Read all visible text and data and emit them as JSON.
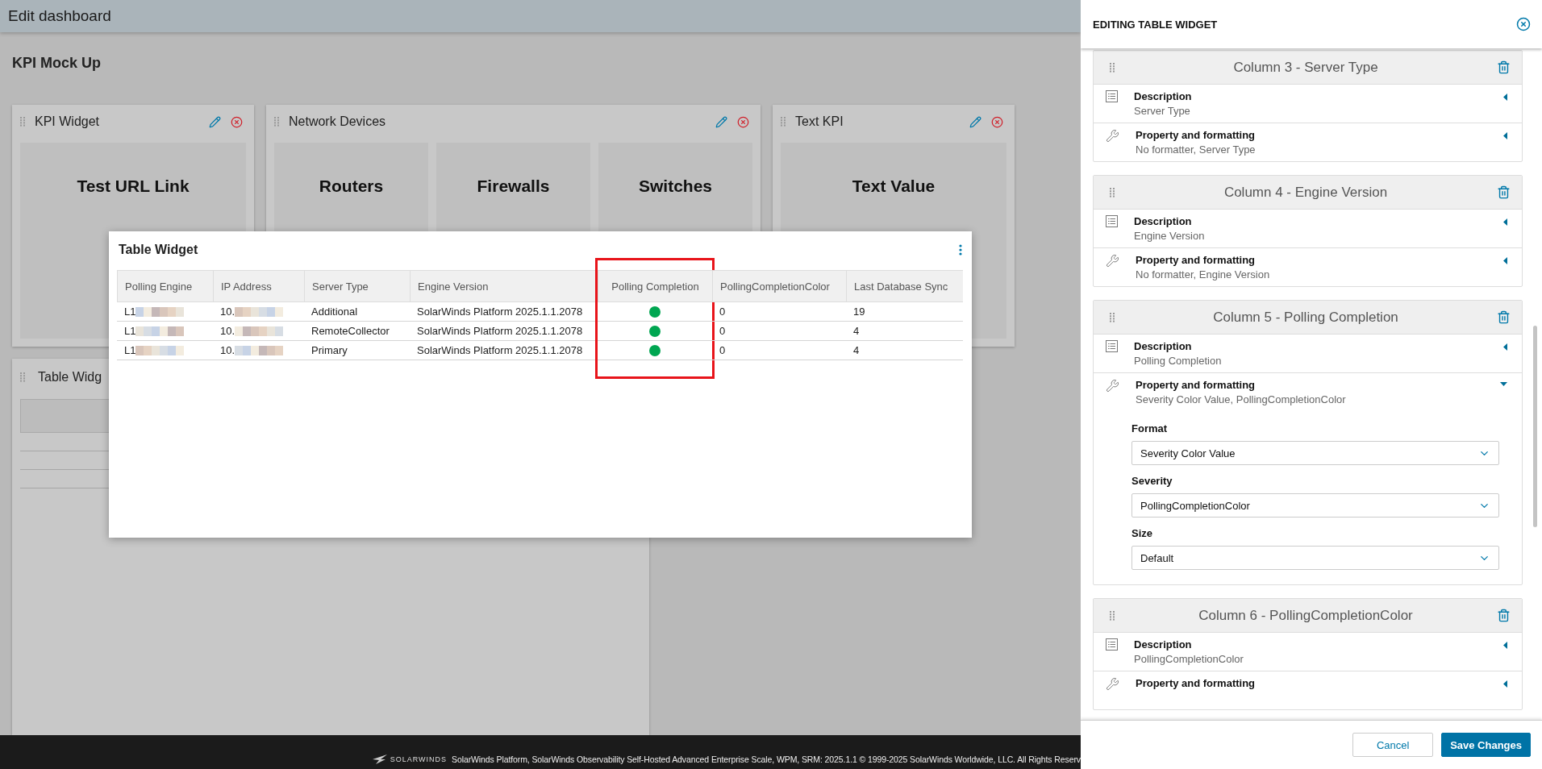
{
  "header": {
    "title": "Edit dashboard"
  },
  "dashboard": {
    "title": "KPI Mock Up",
    "widgets": [
      {
        "title": "KPI Widget",
        "tiles": [
          {
            "label": "Test URL Link"
          }
        ]
      },
      {
        "title": "Network Devices",
        "tiles": [
          {
            "label": "Routers"
          },
          {
            "label": "Firewalls"
          },
          {
            "label": "Switches"
          }
        ]
      },
      {
        "title": "Text KPI",
        "tiles": [
          {
            "label": "Text Value"
          }
        ]
      }
    ],
    "table_widget": {
      "title": "Table Widg"
    }
  },
  "preview": {
    "title": "Table Widget",
    "columns": [
      {
        "label": "Polling Engine",
        "highlighted": false
      },
      {
        "label": "IP Address",
        "highlighted": false
      },
      {
        "label": "Server Type",
        "highlighted": false
      },
      {
        "label": "Engine Version",
        "highlighted": false
      },
      {
        "label": "Polling Completion",
        "highlighted": true
      },
      {
        "label": "PollingCompletionColor",
        "highlighted": false
      },
      {
        "label": "Last Database Sync",
        "highlighted": false
      }
    ],
    "rows": [
      {
        "cells": [
          {
            "kind": "redacted",
            "text": "L1"
          },
          {
            "kind": "redacted",
            "text": "10."
          },
          {
            "kind": "text",
            "text": "Additional"
          },
          {
            "kind": "text",
            "text": "SolarWinds Platform 2025.1.1.2078"
          },
          {
            "kind": "dot",
            "color": "#00a651"
          },
          {
            "kind": "text",
            "text": "0"
          },
          {
            "kind": "text",
            "text": "19"
          }
        ]
      },
      {
        "cells": [
          {
            "kind": "redacted",
            "text": "L1"
          },
          {
            "kind": "redacted",
            "text": "10."
          },
          {
            "kind": "text",
            "text": "RemoteCollector"
          },
          {
            "kind": "text",
            "text": "SolarWinds Platform 2025.1.1.2078"
          },
          {
            "kind": "dot",
            "color": "#00a651"
          },
          {
            "kind": "text",
            "text": "0"
          },
          {
            "kind": "text",
            "text": "4"
          }
        ]
      },
      {
        "cells": [
          {
            "kind": "redacted",
            "text": "L1"
          },
          {
            "kind": "redacted",
            "text": "10."
          },
          {
            "kind": "text",
            "text": "Primary"
          },
          {
            "kind": "text",
            "text": "SolarWinds Platform 2025.1.1.2078"
          },
          {
            "kind": "dot",
            "color": "#00a651"
          },
          {
            "kind": "text",
            "text": "0"
          },
          {
            "kind": "text",
            "text": "4"
          }
        ]
      }
    ]
  },
  "footer": {
    "brand": "SOLARWINDS",
    "text": "SolarWinds Platform, SolarWinds Observability Self-Hosted Advanced Enterprise Scale, WPM, SRM: 2025.1.1 © 1999-2025 SolarWinds Worldwide, LLC. All Rights Reserv"
  },
  "panel": {
    "title": "EDITING TABLE WIDGET",
    "columns": [
      {
        "title": "Column 3 - Server Type",
        "rows": [
          {
            "kind": "description",
            "label": "Description",
            "value": "Server Type",
            "expanded": false
          },
          {
            "kind": "property",
            "label": "Property and formatting",
            "value": "No formatter, Server Type",
            "expanded": false
          }
        ]
      },
      {
        "title": "Column 4 - Engine Version",
        "rows": [
          {
            "kind": "description",
            "label": "Description",
            "value": "Engine Version",
            "expanded": false
          },
          {
            "kind": "property",
            "label": "Property and formatting",
            "value": "No formatter, Engine Version",
            "expanded": false
          }
        ]
      },
      {
        "title": "Column 5 - Polling Completion",
        "rows": [
          {
            "kind": "description",
            "label": "Description",
            "value": "Polling Completion",
            "expanded": false
          },
          {
            "kind": "property",
            "label": "Property and formatting",
            "value": "Severity Color Value, PollingCompletionColor",
            "expanded": true,
            "fields": [
              {
                "label": "Format",
                "value": "Severity Color Value"
              },
              {
                "label": "Severity",
                "value": "PollingCompletionColor"
              },
              {
                "label": "Size",
                "value": "Default"
              }
            ]
          }
        ]
      },
      {
        "title": "Column 6 - PollingCompletionColor",
        "rows": [
          {
            "kind": "description",
            "label": "Description",
            "value": "PollingCompletionColor",
            "expanded": false
          },
          {
            "kind": "property",
            "label": "Property and formatting",
            "expanded": false
          }
        ]
      }
    ],
    "buttons": [
      {
        "label": "Cancel",
        "kind": "secondary"
      },
      {
        "label": "Save Changes",
        "kind": "primary"
      }
    ]
  }
}
